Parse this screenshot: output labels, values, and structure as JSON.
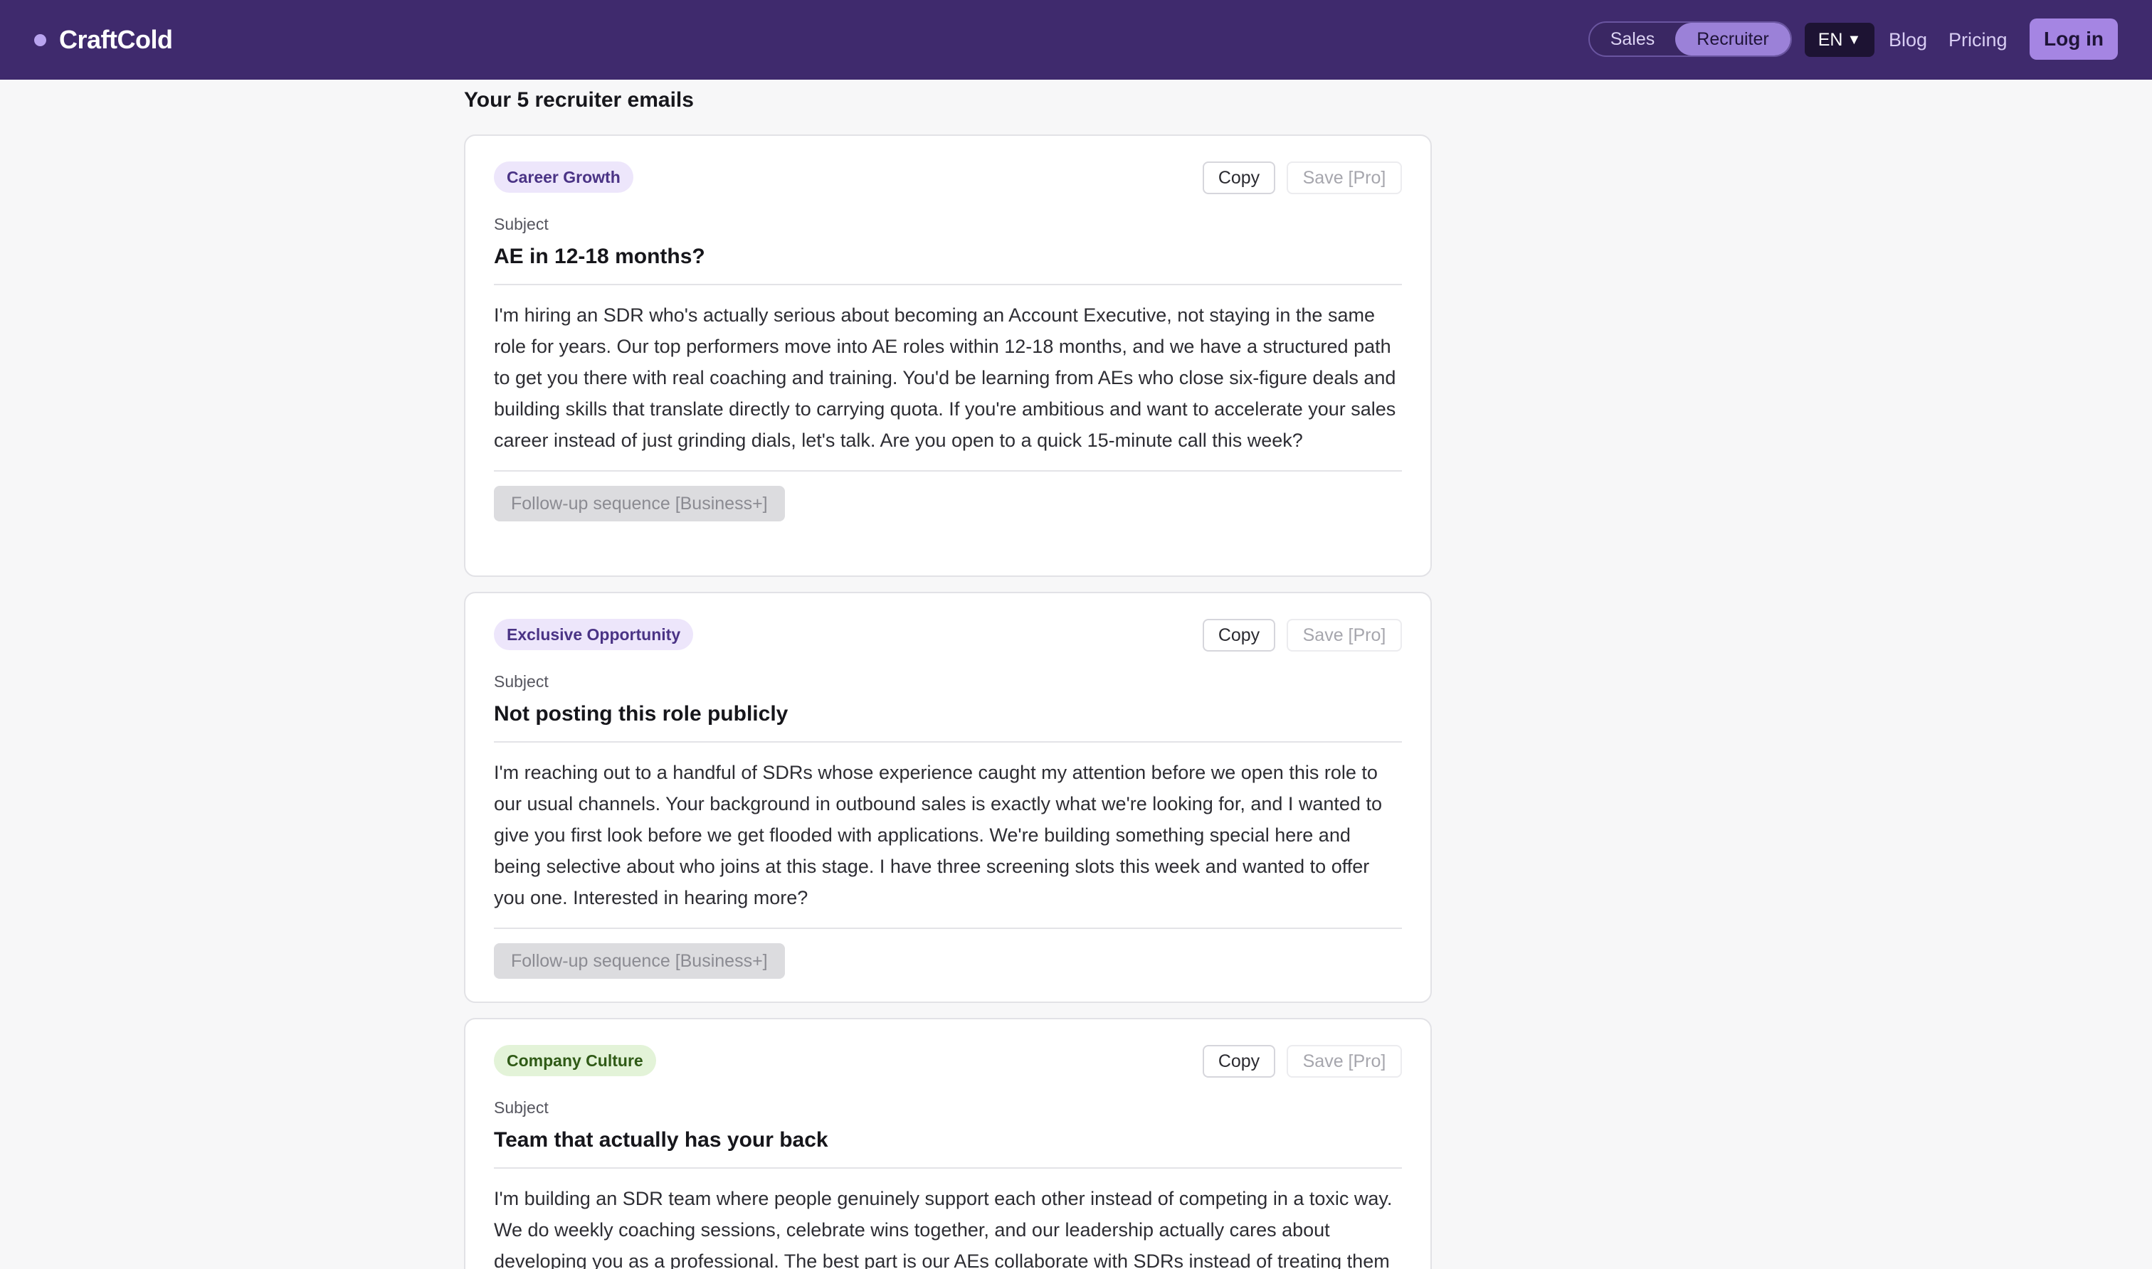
{
  "header": {
    "brand": "CraftCold",
    "mode_toggle": {
      "sales": "Sales",
      "recruiter": "Recruiter",
      "active": "Recruiter"
    },
    "language": "EN",
    "nav": {
      "blog": "Blog",
      "pricing": "Pricing"
    },
    "login": "Log in"
  },
  "main": {
    "title": "Your 5 recruiter emails",
    "cards": [
      {
        "tag": "Career Growth",
        "copy": "Copy",
        "save": "Save [Pro]",
        "subject_label": "Subject",
        "subject": "AE in 12-18 months?",
        "body": "I'm hiring an SDR who's actually serious about becoming an Account Executive, not staying in the same role for years. Our top performers move into AE roles within 12-18 months, and we have a structured path to get you there with real coaching and training. You'd be learning from AEs who close six-figure deals and building skills that translate directly to carrying quota. If you're ambitious and want to accelerate your sales career instead of just grinding dials, let's talk. Are you open to a quick 15-minute call this week?",
        "followup": "Follow-up sequence [Business+]"
      },
      {
        "tag": "Exclusive Opportunity",
        "copy": "Copy",
        "save": "Save [Pro]",
        "subject_label": "Subject",
        "subject": "Not posting this role publicly",
        "body": "I'm reaching out to a handful of SDRs whose experience caught my attention before we open this role to our usual channels. Your background in outbound sales is exactly what we're looking for, and I wanted to give you first look before we get flooded with applications. We're building something special here and being selective about who joins at this stage. I have three screening slots this week and wanted to offer you one. Interested in hearing more?",
        "followup": "Follow-up sequence [Business+]"
      },
      {
        "tag": "Company Culture",
        "copy": "Copy",
        "save": "Save [Pro]",
        "subject_label": "Subject",
        "subject": "Team that actually has your back",
        "body": "I'm building an SDR team where people genuinely support each other instead of competing in a toxic way. We do weekly coaching sessions, celebrate wins together, and our leadership actually cares about developing you as a professional. The best part is our AEs collaborate with SDRs instead of treating them"
      }
    ]
  }
}
